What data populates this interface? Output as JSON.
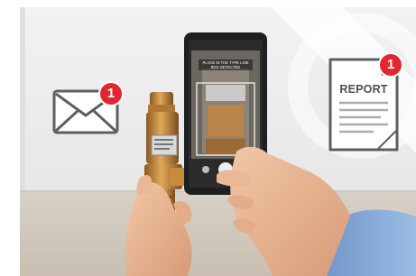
{
  "icons": {
    "envelope": "envelope-icon",
    "report": "report-document-icon",
    "phone": "smartphone",
    "valve": "brass-safety-valve"
  },
  "notifications": {
    "envelope_badge": "1",
    "report_badge": "1"
  },
  "report_label": "REPORT",
  "phone_screen_text": "PLACE IN THE TYPE LINE BOX DETECTED",
  "colors": {
    "badge": "#e2262f",
    "icon_stroke": "#5a5f66",
    "brass": "#c98a3c",
    "phone_body": "#1e1f22",
    "sleeve": "#7fa6d6"
  }
}
